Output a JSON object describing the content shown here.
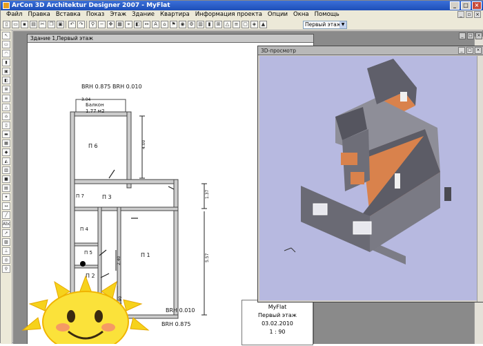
{
  "window": {
    "title": "ArCon 3D Architektur Designer 2007 - MyFlat",
    "buttons": [
      "_",
      "□",
      "×"
    ]
  },
  "menu": {
    "items": [
      "Файл",
      "Правка",
      "Вставка",
      "Показ",
      "Этаж",
      "Здание",
      "Квартира",
      "Информация проекта",
      "Опции",
      "Окна",
      "Помощь"
    ]
  },
  "toolbar": {
    "floor_select": "Первый этаж"
  },
  "plan_window": {
    "title": "Здание 1,Первый этаж",
    "labels": {
      "brh_top": "BRH 0.875  BRH 0.010",
      "balcony": "Балкон",
      "balcony_area": "1.77 м2",
      "dim_304": "3.04",
      "room6": "П 6",
      "room7": "П 7",
      "room3": "П 3",
      "room4": "П 4",
      "room5": "П 5",
      "room2": "П 2",
      "room1": "П 1",
      "dim_400": "4.00",
      "dim_137": "1.37",
      "dim_557": "5.57",
      "dim_240": "2.40",
      "dim_290": "2.90",
      "brh_b1": "BRH 0.010",
      "brh_b2": "BRH 0.875"
    },
    "stamp": {
      "project": "MyFlat",
      "floor": "Первый этаж",
      "date": "03.02.2010",
      "scale": "1 : 90"
    }
  },
  "view3d": {
    "title": "3D-просмотр"
  },
  "colors": {
    "titlebar": "#1e4fb8",
    "floor": "#d9824c",
    "walls": "#5f5f66",
    "background3d": "#b7b9e0"
  }
}
